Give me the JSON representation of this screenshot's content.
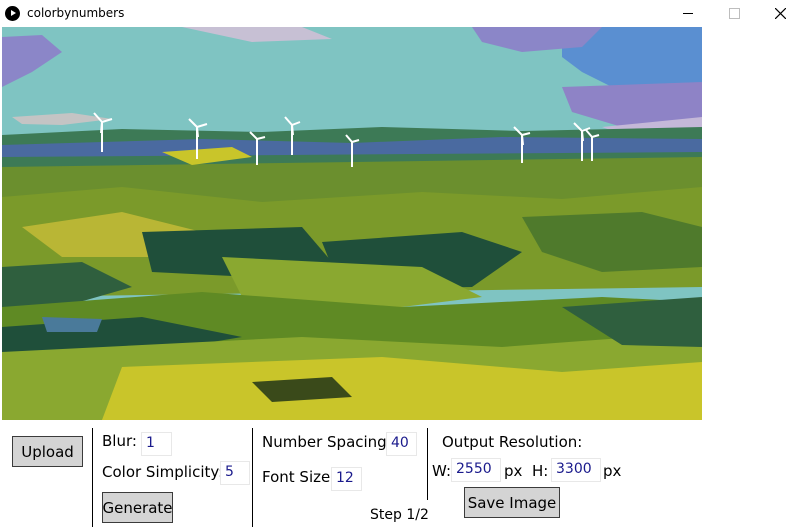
{
  "window": {
    "title": "colorbynumbers",
    "controls": [
      "minimize-icon",
      "maximize-icon",
      "close-icon"
    ]
  },
  "canvas": {
    "scene_icons": [
      "posterized-landscape-photo",
      "wind-turbine-icon"
    ]
  },
  "panel": {
    "upload_label": "Upload",
    "blur_label": "Blur:",
    "blur_value": "1",
    "color_simplicity_label": "Color Simplicity:",
    "color_simplicity_value": "5",
    "generate_label": "Generate",
    "number_spacing_label": "Number Spacing:",
    "number_spacing_value": "40",
    "font_size_label": "Font Size:",
    "font_size_value": "12",
    "output_resolution_label": "Output Resolution:",
    "width_label": "W:",
    "width_value": "2550",
    "width_unit": "px",
    "height_label": "H:",
    "height_value": "3300",
    "height_unit": "px",
    "save_label": "Save Image",
    "step_text": "Step 1/2"
  },
  "colors": {
    "sky": "#7fc4c2",
    "hills": "#6b8f2e",
    "dark_green": "#1f4f3a",
    "yellow": "#c9c52a",
    "button_bg": "#d4d4d4",
    "field_text": "#1a1a8c"
  }
}
